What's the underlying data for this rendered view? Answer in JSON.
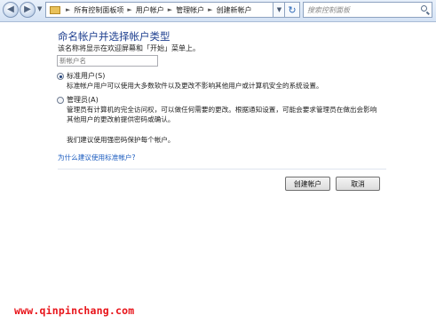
{
  "nav": {
    "back_icon": "back-arrow-icon",
    "forward_icon": "forward-arrow-icon",
    "breadcrumbs": [
      "所有控制面板项",
      "用户帐户",
      "管理帐户",
      "创建新帐户"
    ],
    "search_placeholder": "搜索控制面板"
  },
  "page": {
    "title": "命名帐户并选择帐户类型",
    "instruction": "该名称将显示在欢迎屏幕和「开始」菜单上。",
    "name_placeholder": "新帐户名",
    "options": [
      {
        "label": "标准用户(S)",
        "selected": true,
        "description": [
          "标准帐户用户可以使用大多数软件以及更改不影响其他用户或计算机安全的系统设置。"
        ]
      },
      {
        "label": "管理员(A)",
        "selected": false,
        "description": [
          "管理员有计算机的完全访问权，可以做任何需要的更改。根据通知设置，可能会要求管理员在做出会影响",
          "其他用户的更改前提供密码或确认。"
        ]
      }
    ],
    "recommendation": "我们建议使用强密码保护每个帐户。",
    "help_link": "为什么建议使用标准帐户?",
    "create_button": "创建帐户",
    "cancel_button": "取消"
  },
  "watermark": "www.qinpinchang.com",
  "colors": {
    "title": "#1e3f8f",
    "link": "#1a5bbf",
    "watermark": "#e8141a"
  }
}
